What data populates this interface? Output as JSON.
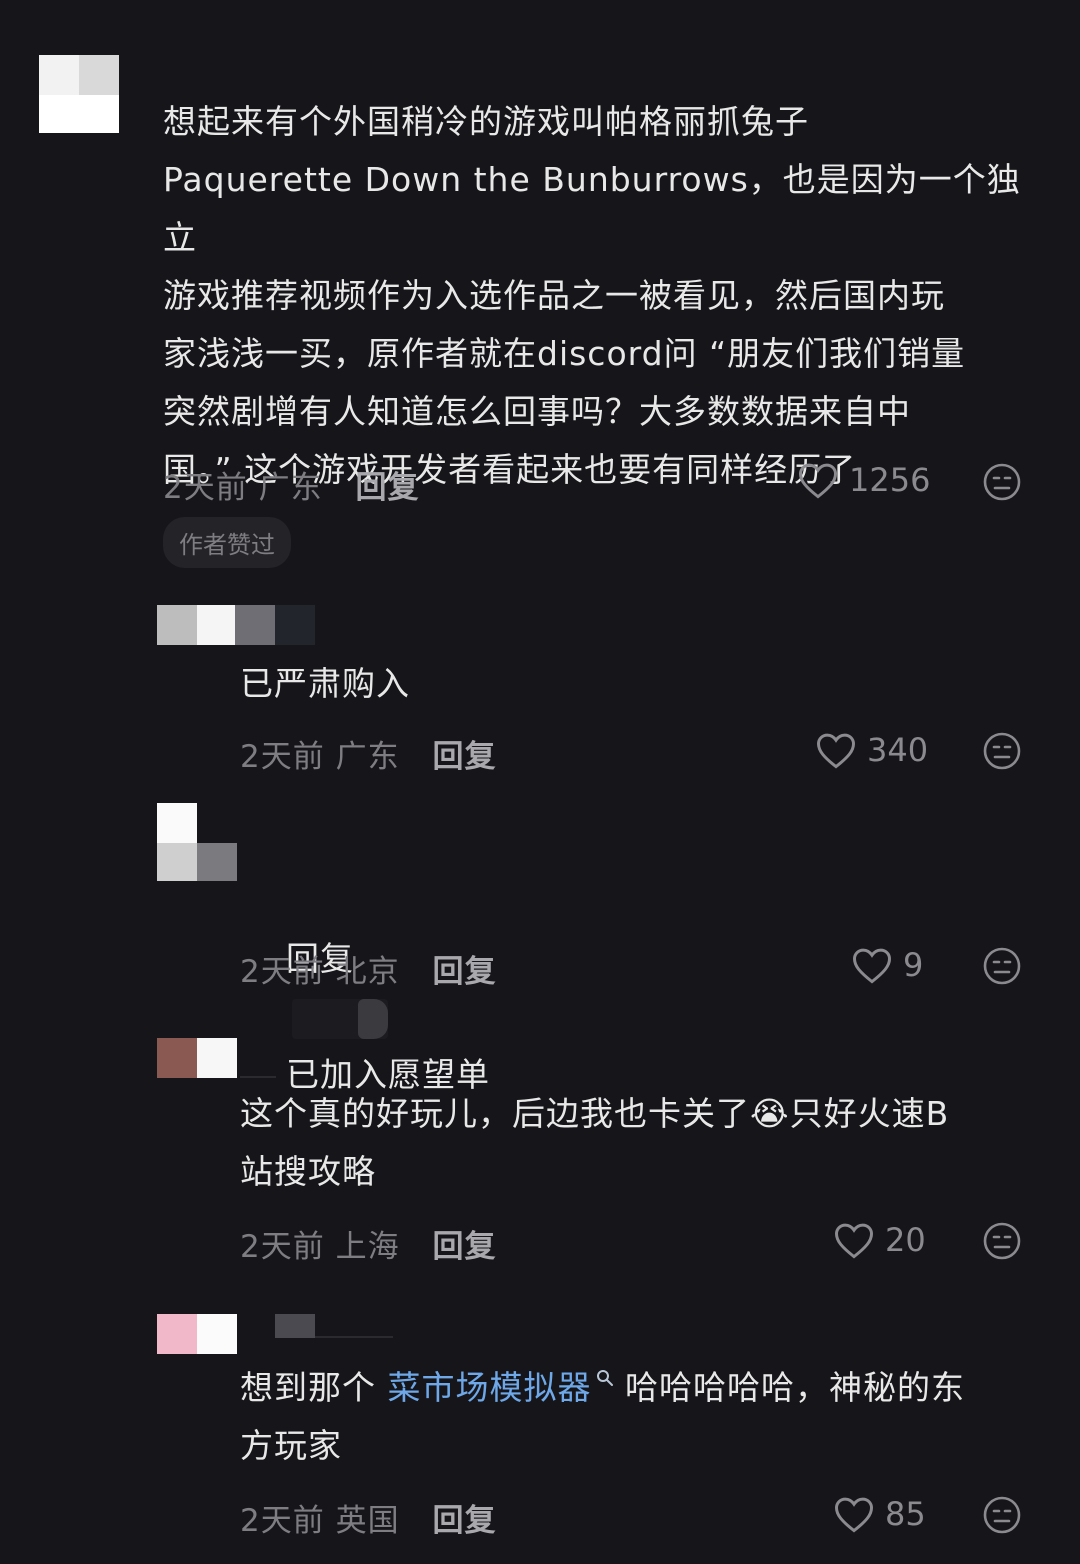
{
  "comments": [
    {
      "text": "想起来有个外国稍冷的游戏叫帕格丽抓兔子\nPaquerette Down the Bunburrows，也是因为一个独立\n游戏推荐视频作为入选作品之一被看见，然后国内玩\n家浅浅一买，原作者就在discord问 “朋友们我们销量\n突然剧增有人知道怎么回事吗？大多数数据来自中\n国。” 这个游戏开发者看起来也要有同样经历了",
      "time": "2天前",
      "location": "广东",
      "reply_label": "回复",
      "likes": "1256",
      "badge": "作者赞过"
    },
    {
      "text": "已严肃购入",
      "time": "2天前",
      "location": "广东",
      "reply_label": "回复",
      "likes": "340"
    },
    {
      "reply_prefix": "回复",
      "text": "已加入愿望单",
      "time": "2天前",
      "location": "北京",
      "reply_label": "回复",
      "likes": "9"
    },
    {
      "text_before": "这个真的好玩儿，后边我也卡关了",
      "emoji": "😭",
      "text_after": "只好火速B\n站搜攻略",
      "time": "2天前",
      "location": "上海",
      "reply_label": "回复",
      "likes": "20"
    },
    {
      "text_before": "想到那个 ",
      "link_text": "菜市场模拟器",
      "text_after": " 哈哈哈哈哈，神秘的东\n方玩家",
      "time": "2天前",
      "location": "英国",
      "reply_label": "回复",
      "likes": "85"
    }
  ],
  "icons": {
    "like": "heart-outline-icon",
    "react": "neutral-face-icon",
    "link_search": "search-icon"
  },
  "colors": {
    "background": "#16161a",
    "text": "#e8e8e8",
    "meta": "#7d7d82",
    "link": "#6ea8e8"
  }
}
